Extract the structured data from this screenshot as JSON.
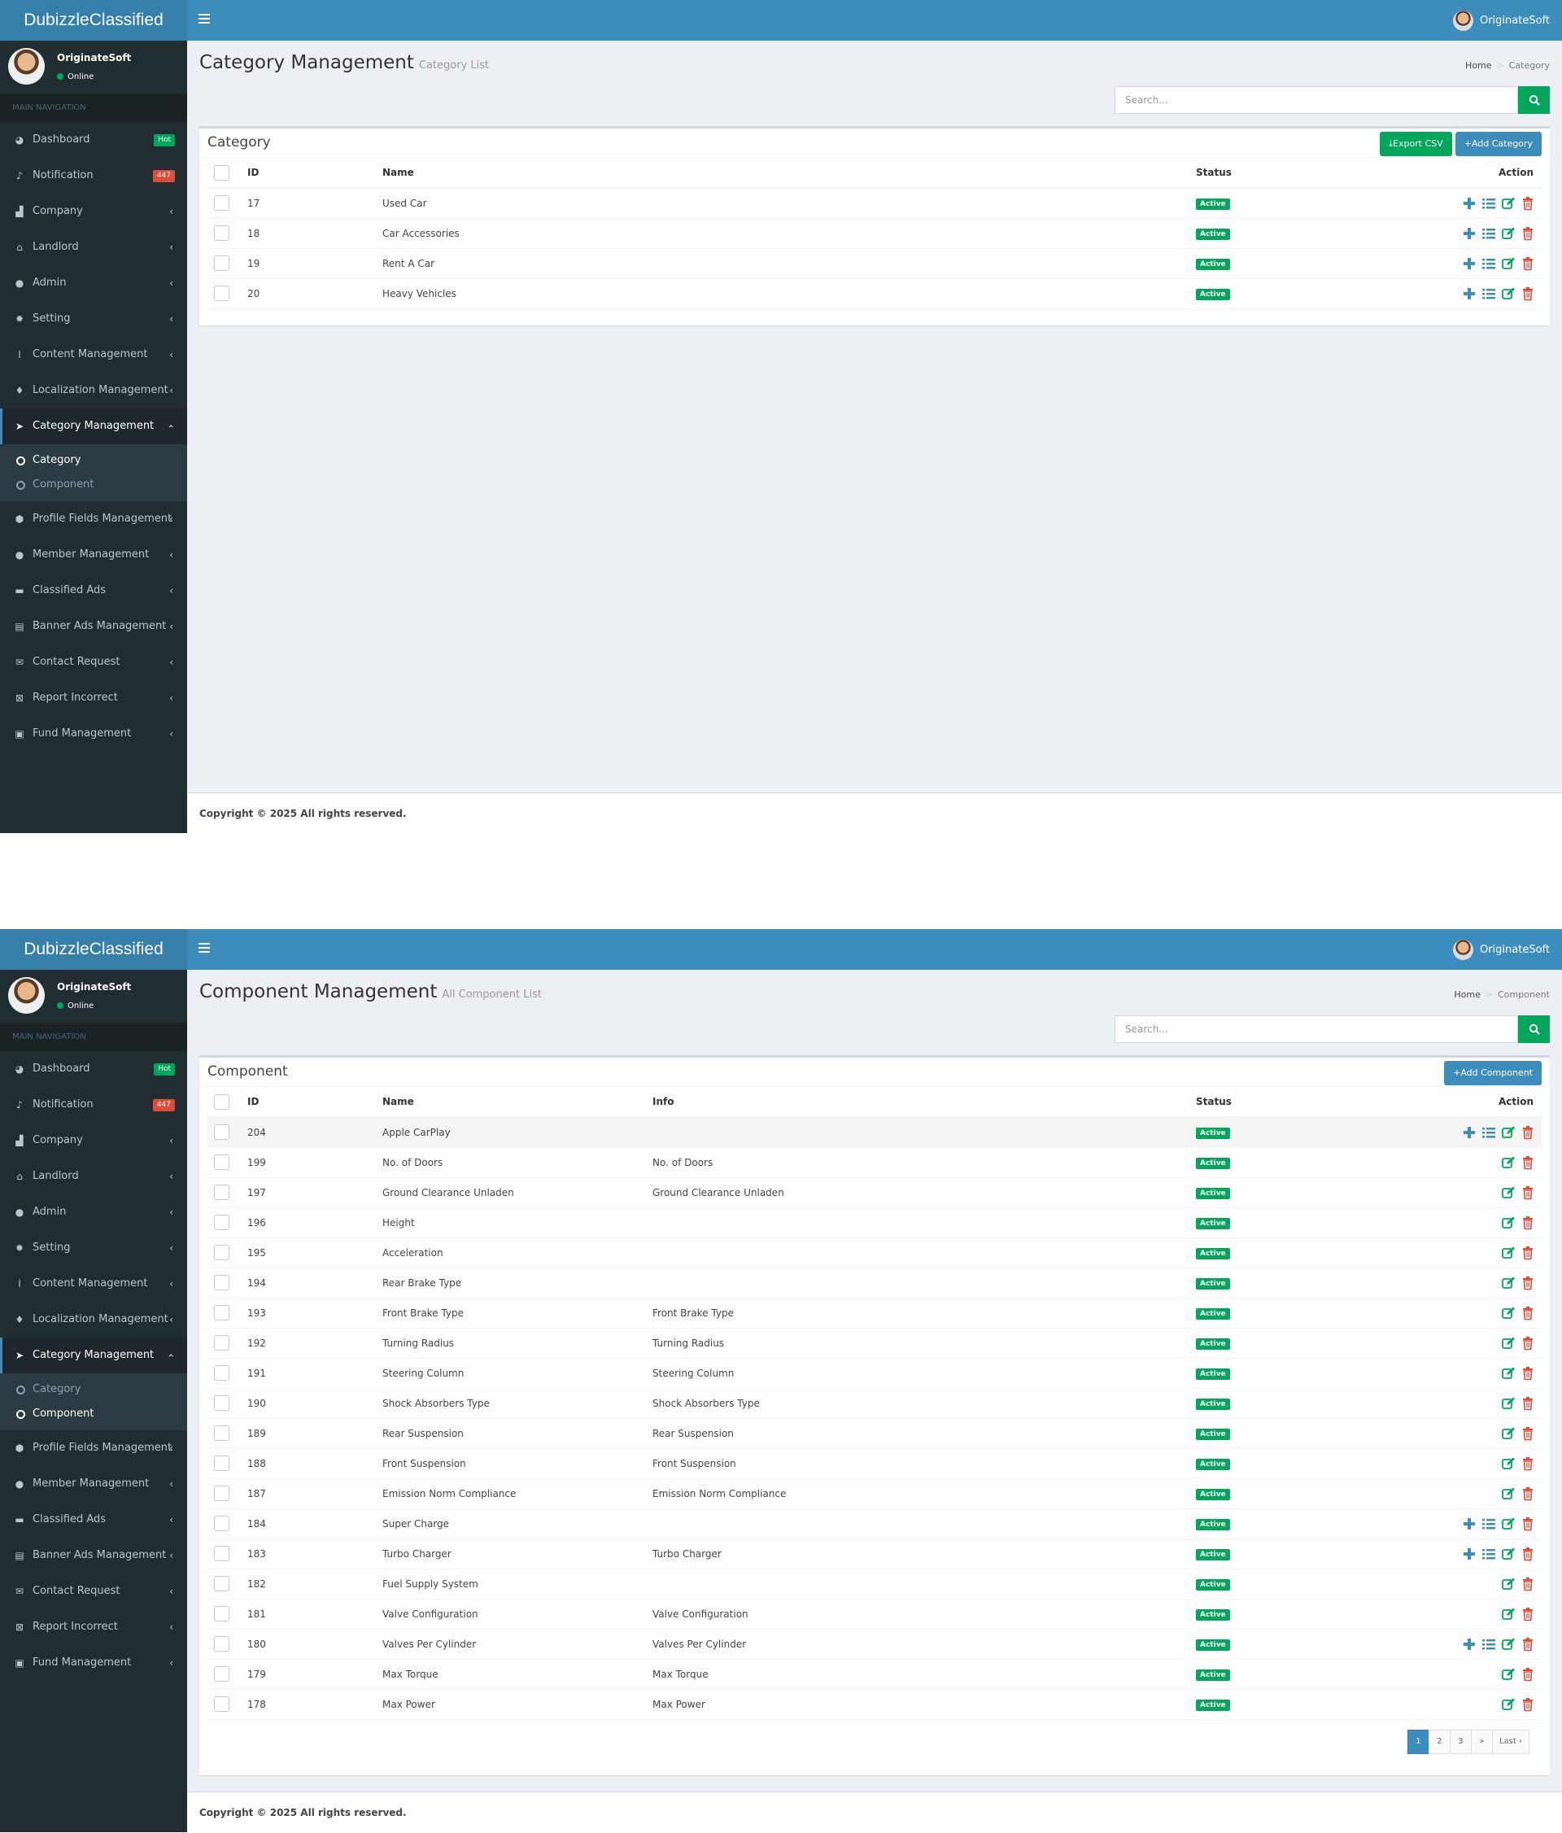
{
  "app_title": "DubizzleClassified",
  "top_user": "OriginateSoft",
  "user_panel": {
    "name": "OriginateSoft",
    "status": "Online"
  },
  "nav_header": "MAIN NAVIGATION",
  "nav": {
    "dashboard": "Dashboard",
    "dashboard_badge": "Hot",
    "notification": "Notification",
    "notification_badge": "447",
    "company": "Company",
    "landlord": "Landlord",
    "admin": "Admin",
    "setting": "Setting",
    "content": "Content Management",
    "localization": "Localization Management",
    "category_mgmt": "Category Management",
    "sub_category": "Category",
    "sub_component": "Component",
    "profile_fields": "Profile Fields Management",
    "member": "Member Management",
    "classified": "Classified Ads",
    "banner": "Banner Ads Management",
    "contact": "Contact Request",
    "report": "Report Incorrect",
    "fund": "Fund Management"
  },
  "colors": {
    "header": "#3c8dbc",
    "logo_bg": "#367fa9",
    "sidebar": "#222d32",
    "success": "#00a65a",
    "danger": "#dd4b39"
  },
  "breadcrumb_home": "Home",
  "search_placeholder": "Search...",
  "copyright": "Copyright © 2025 All rights reserved.",
  "category_page": {
    "title": "Category Management",
    "subtitle": "Category List",
    "crumb": "Category",
    "box_title": "Category",
    "export_btn": "Export CSV",
    "add_btn": "Add Category",
    "columns": {
      "id": "ID",
      "name": "Name",
      "status": "Status",
      "action": "Action"
    },
    "rows": [
      {
        "id": "17",
        "name": "Used Car",
        "status": "Active"
      },
      {
        "id": "18",
        "name": "Car Accessories",
        "status": "Active"
      },
      {
        "id": "19",
        "name": "Rent A Car",
        "status": "Active"
      },
      {
        "id": "20",
        "name": "Heavy Vehicles",
        "status": "Active"
      }
    ]
  },
  "component_page": {
    "title": "Component Management",
    "subtitle": "All Component List",
    "crumb": "Component",
    "box_title": "Component",
    "add_btn": "Add Component",
    "columns": {
      "id": "ID",
      "name": "Name",
      "info": "Info",
      "status": "Status",
      "action": "Action"
    },
    "rows": [
      {
        "id": "204",
        "name": "Apple CarPlay",
        "info": "",
        "status": "Active",
        "full_actions": true
      },
      {
        "id": "199",
        "name": "No. of Doors",
        "info": "No. of Doors",
        "status": "Active",
        "full_actions": false
      },
      {
        "id": "197",
        "name": "Ground Clearance Unladen",
        "info": "Ground Clearance Unladen",
        "status": "Active",
        "full_actions": false
      },
      {
        "id": "196",
        "name": "Height",
        "info": "",
        "status": "Active",
        "full_actions": false
      },
      {
        "id": "195",
        "name": "Acceleration",
        "info": "",
        "status": "Active",
        "full_actions": false
      },
      {
        "id": "194",
        "name": "Rear Brake Type",
        "info": "",
        "status": "Active",
        "full_actions": false
      },
      {
        "id": "193",
        "name": "Front Brake Type",
        "info": "Front Brake Type",
        "status": "Active",
        "full_actions": false
      },
      {
        "id": "192",
        "name": "Turning Radius",
        "info": "Turning Radius",
        "status": "Active",
        "full_actions": false
      },
      {
        "id": "191",
        "name": "Steering Column",
        "info": "Steering Column",
        "status": "Active",
        "full_actions": false
      },
      {
        "id": "190",
        "name": "Shock Absorbers Type",
        "info": "Shock Absorbers Type",
        "status": "Active",
        "full_actions": false
      },
      {
        "id": "189",
        "name": "Rear Suspension",
        "info": "Rear Suspension",
        "status": "Active",
        "full_actions": false
      },
      {
        "id": "188",
        "name": "Front Suspension",
        "info": "Front Suspension",
        "status": "Active",
        "full_actions": false
      },
      {
        "id": "187",
        "name": "Emission Norm Compliance",
        "info": "Emission Norm Compliance",
        "status": "Active",
        "full_actions": false
      },
      {
        "id": "184",
        "name": "Super Charge",
        "info": "",
        "status": "Active",
        "full_actions": true
      },
      {
        "id": "183",
        "name": "Turbo Charger",
        "info": "Turbo Charger",
        "status": "Active",
        "full_actions": true
      },
      {
        "id": "182",
        "name": "Fuel Supply System",
        "info": "",
        "status": "Active",
        "full_actions": false
      },
      {
        "id": "181",
        "name": "Valve Configuration",
        "info": "Valve Configuration",
        "status": "Active",
        "full_actions": false
      },
      {
        "id": "180",
        "name": "Valves Per Cylinder",
        "info": "Valves Per Cylinder",
        "status": "Active",
        "full_actions": true
      },
      {
        "id": "179",
        "name": "Max Torque",
        "info": "Max Torque",
        "status": "Active",
        "full_actions": false
      },
      {
        "id": "178",
        "name": "Max Power",
        "info": "Max Power",
        "status": "Active",
        "full_actions": false
      }
    ],
    "pagination": [
      "1",
      "2",
      "3",
      "»",
      "Last ›"
    ]
  }
}
